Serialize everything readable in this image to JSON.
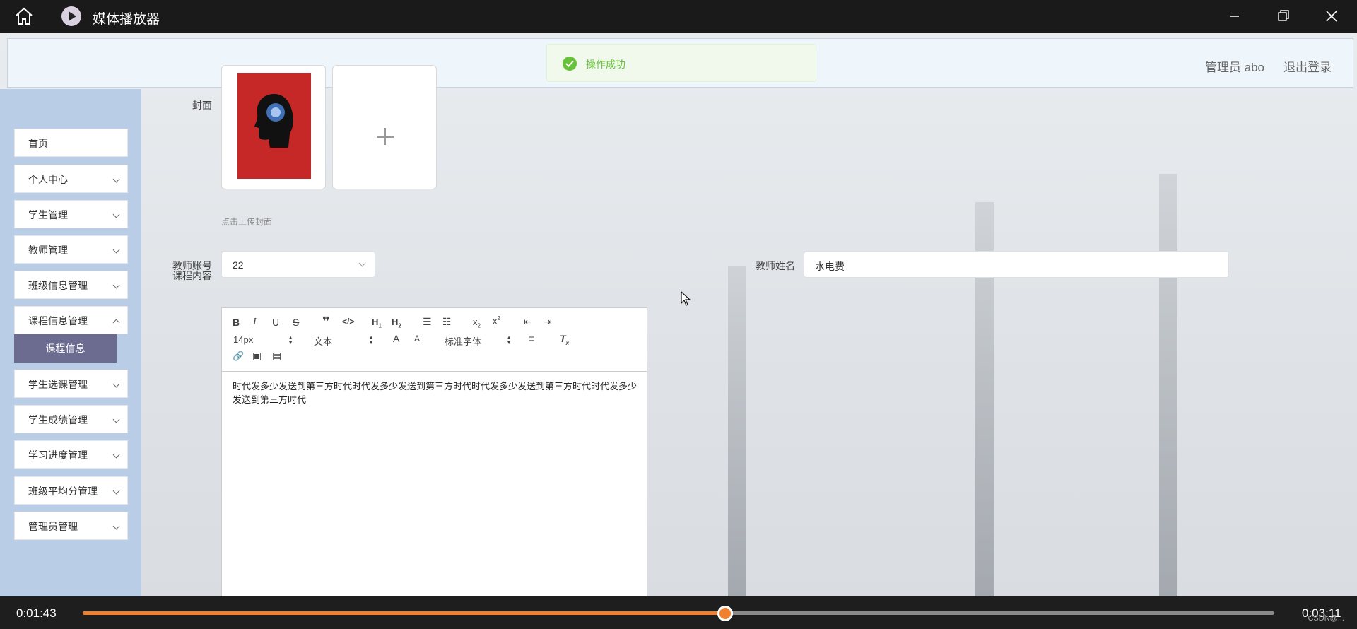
{
  "window": {
    "title": "媒体播放器"
  },
  "header": {
    "user": "管理员 abo",
    "logout": "退出登录"
  },
  "toast": {
    "message": "操作成功"
  },
  "sidebar": {
    "items": [
      {
        "label": "首页",
        "has_arrow": false
      },
      {
        "label": "个人中心",
        "has_arrow": true
      },
      {
        "label": "学生管理",
        "has_arrow": true
      },
      {
        "label": "教师管理",
        "has_arrow": true
      },
      {
        "label": "班级信息管理",
        "has_arrow": true
      },
      {
        "label": "课程信息管理",
        "has_arrow": true
      },
      {
        "label": "学生选课管理",
        "has_arrow": true
      },
      {
        "label": "学生成绩管理",
        "has_arrow": true
      },
      {
        "label": "学习进度管理",
        "has_arrow": true
      },
      {
        "label": "班级平均分管理",
        "has_arrow": true
      },
      {
        "label": "管理员管理",
        "has_arrow": true
      }
    ],
    "active_sub": "课程信息"
  },
  "form": {
    "cover_label": "封面",
    "cover_hint": "点击上传封面",
    "teacher_account_label": "教师账号",
    "teacher_account_value": "22",
    "teacher_name_label": "教师姓名",
    "teacher_name_value": "水电费",
    "content_label": "课程内容"
  },
  "editor": {
    "font_size": "14px",
    "format": "文本",
    "font_family": "标准字体",
    "content": "时代发多少发送到第三方时代时代发多少发送到第三方时代时代发多少发送到第三方时代时代发多少发送到第三方时代"
  },
  "player": {
    "current": "0:01:43",
    "total": "0:03:11",
    "progress": 0.539,
    "watermark": "CSDN@..."
  },
  "colors": {
    "accent": "#f07f2e",
    "sidebar_active": "#6b6c90",
    "success": "#67c23a"
  }
}
